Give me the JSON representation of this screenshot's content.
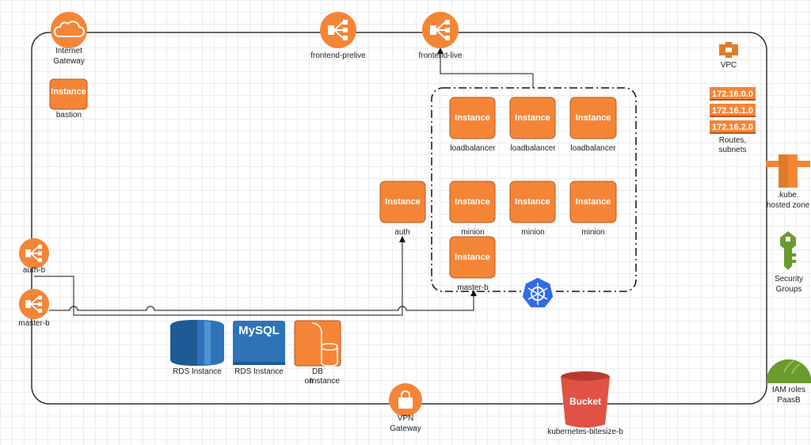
{
  "colors": {
    "orange": "#f58536",
    "orange_dark": "#b9551a",
    "blue": "#2f6fb7",
    "k8s": "#326ce5",
    "green": "#6b9a2f",
    "red": "#e05243"
  },
  "vpc": {
    "label": "VPC"
  },
  "internet_gateway": {
    "line1": "Internet",
    "line2": "Gateway",
    "icon": "cloud-icon"
  },
  "bastion": {
    "title": "Instance",
    "label": "bastion"
  },
  "frontend_prelive": {
    "label": "frontend-prelive",
    "icon": "load-balancer-icon"
  },
  "frontend_live": {
    "label": "frontend-live",
    "icon": "load-balancer-icon"
  },
  "routes": {
    "subnets": [
      "172.16.0.0",
      "172.16.1.0",
      "172.16.2.0"
    ],
    "line1": "Routes,",
    "line2": "subnets"
  },
  "hosted_zone": {
    "line1": ".kube.",
    "line2": "hosted zone"
  },
  "security_groups": {
    "line1": "Security",
    "line2": "Groups"
  },
  "iam": {
    "line1": "IAM roles",
    "line2": "PaasB"
  },
  "auth": {
    "title": "Instance",
    "label": "auth"
  },
  "cluster": {
    "loadbalancers": [
      {
        "title": "Instance",
        "label": "loadbalancer"
      },
      {
        "title": "Instance",
        "label": "loadbalancer"
      },
      {
        "title": "Instance",
        "label": "loadbalancer"
      }
    ],
    "minions": [
      {
        "title": "Instance",
        "label": "minion"
      },
      {
        "title": "Instance",
        "label": "minion"
      },
      {
        "title": "Instance",
        "label": "minion"
      }
    ],
    "master": {
      "title": "Instance",
      "label": "master-b"
    }
  },
  "auth_b": {
    "label": "auth-b"
  },
  "master_b": {
    "label": "master-b"
  },
  "rds1": {
    "label": "RDS Instance"
  },
  "rds2": {
    "label": "RDS Instance",
    "badge": "MySQL"
  },
  "db_on_instance": {
    "line1": "DB",
    "line2": "on",
    "line3": "Instance"
  },
  "vpn": {
    "line1": "VPN",
    "line2": "Gateway"
  },
  "bucket": {
    "title": "Bucket",
    "label": "kubernetes-bitesize-b"
  }
}
